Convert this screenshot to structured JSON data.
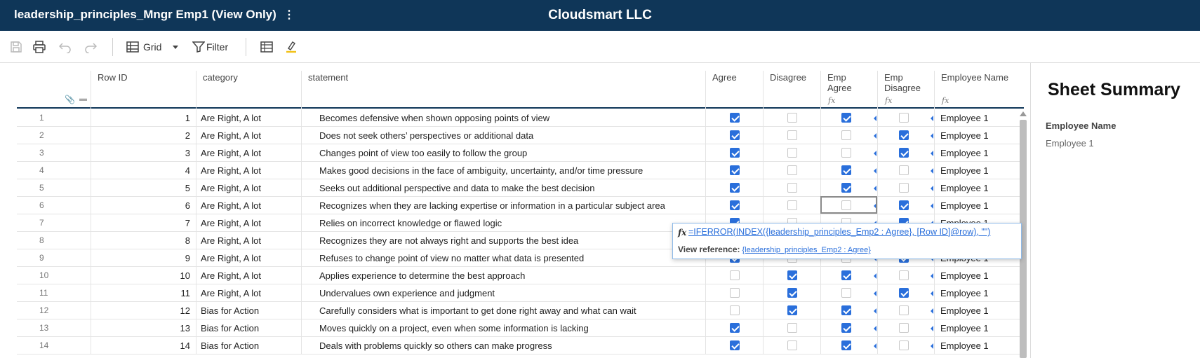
{
  "app": {
    "sheet_title": "leadership_principles_Mngr Emp1 (View Only)",
    "more_menu": "⋮",
    "company": "Cloudsmart LLC"
  },
  "toolbar": {
    "view_label": "Grid",
    "filter_label": "Filter"
  },
  "columns": {
    "row_id": "Row ID",
    "category": "category",
    "statement": "statement",
    "agree": "Agree",
    "disagree": "Disagree",
    "emp_agree": "Emp Agree",
    "emp_disagree": "Emp Disagree",
    "employee_name": "Employee Name",
    "fx": "fx"
  },
  "rows": [
    {
      "n": "1",
      "id": "1",
      "category": "Are Right, A lot",
      "statement": "Becomes defensive when shown opposing points of view",
      "agree": true,
      "disagree": false,
      "emp_agree": true,
      "emp_disagree": false,
      "employee": "Employee 1"
    },
    {
      "n": "2",
      "id": "2",
      "category": "Are Right, A lot",
      "statement": "Does not seek others’ perspectives or additional data",
      "agree": true,
      "disagree": false,
      "emp_agree": false,
      "emp_disagree": true,
      "employee": "Employee 1"
    },
    {
      "n": "3",
      "id": "3",
      "category": "Are Right, A lot",
      "statement": "Changes point of view too easily to follow the group",
      "agree": true,
      "disagree": false,
      "emp_agree": false,
      "emp_disagree": true,
      "employee": "Employee 1"
    },
    {
      "n": "4",
      "id": "4",
      "category": "Are Right, A lot",
      "statement": "Makes good decisions in the face of ambiguity, uncertainty, and/or time pressure",
      "agree": true,
      "disagree": false,
      "emp_agree": true,
      "emp_disagree": false,
      "employee": "Employee 1"
    },
    {
      "n": "5",
      "id": "5",
      "category": "Are Right, A lot",
      "statement": "Seeks out additional perspective and data to make the best decision",
      "agree": true,
      "disagree": false,
      "emp_agree": true,
      "emp_disagree": false,
      "employee": "Employee 1"
    },
    {
      "n": "6",
      "id": "6",
      "category": "Are Right, A lot",
      "statement": "Recognizes when they are lacking expertise or information in a particular subject area",
      "agree": true,
      "disagree": false,
      "emp_agree": false,
      "emp_disagree": true,
      "employee": "Employee 1"
    },
    {
      "n": "7",
      "id": "7",
      "category": "Are Right, A lot",
      "statement": "Relies on incorrect knowledge or flawed logic",
      "agree": true,
      "disagree": false,
      "emp_agree": false,
      "emp_disagree": true,
      "employee": "Employee 1"
    },
    {
      "n": "8",
      "id": "8",
      "category": "Are Right, A lot",
      "statement": "Recognizes they are not always right and supports the best idea",
      "agree": true,
      "disagree": false,
      "emp_agree": true,
      "emp_disagree": false,
      "employee": "Employee 1"
    },
    {
      "n": "9",
      "id": "9",
      "category": "Are Right, A lot",
      "statement": "Refuses to change point of view no matter what data is presented",
      "agree": true,
      "disagree": false,
      "emp_agree": false,
      "emp_disagree": true,
      "employee": "Employee 1"
    },
    {
      "n": "10",
      "id": "10",
      "category": "Are Right, A lot",
      "statement": "Applies experience to determine the best approach",
      "agree": false,
      "disagree": true,
      "emp_agree": true,
      "emp_disagree": false,
      "employee": "Employee 1"
    },
    {
      "n": "11",
      "id": "11",
      "category": "Are Right, A lot",
      "statement": "Undervalues own experience and judgment",
      "agree": false,
      "disagree": true,
      "emp_agree": false,
      "emp_disagree": true,
      "employee": "Employee 1"
    },
    {
      "n": "12",
      "id": "12",
      "category": "Bias for Action",
      "statement": "Carefully considers what is important to get done right away and what can wait",
      "agree": false,
      "disagree": true,
      "emp_agree": true,
      "emp_disagree": false,
      "employee": "Employee 1"
    },
    {
      "n": "13",
      "id": "13",
      "category": "Bias for Action",
      "statement": "Moves quickly on a project, even when some information is lacking",
      "agree": true,
      "disagree": false,
      "emp_agree": true,
      "emp_disagree": false,
      "employee": "Employee 1"
    },
    {
      "n": "14",
      "id": "14",
      "category": "Bias for Action",
      "statement": "Deals with problems quickly so others can make progress",
      "agree": true,
      "disagree": false,
      "emp_agree": true,
      "emp_disagree": false,
      "employee": "Employee 1"
    }
  ],
  "tooltip": {
    "fx_symbol": "fx",
    "formula": "=IFERROR(INDEX({leadership_principles_Emp2 : Agree}, [Row ID]@row), \"\")",
    "view_reference_label": "View reference:",
    "view_reference_link": "{leadership_principles_Emp2 : Agree}"
  },
  "summary": {
    "title": "Sheet Summary",
    "field_label": "Employee Name",
    "field_value": "Employee 1"
  },
  "colors": {
    "header_bg": "#0f3658",
    "checkbox_on": "#2a6fdb",
    "link": "#2a6fdb"
  }
}
